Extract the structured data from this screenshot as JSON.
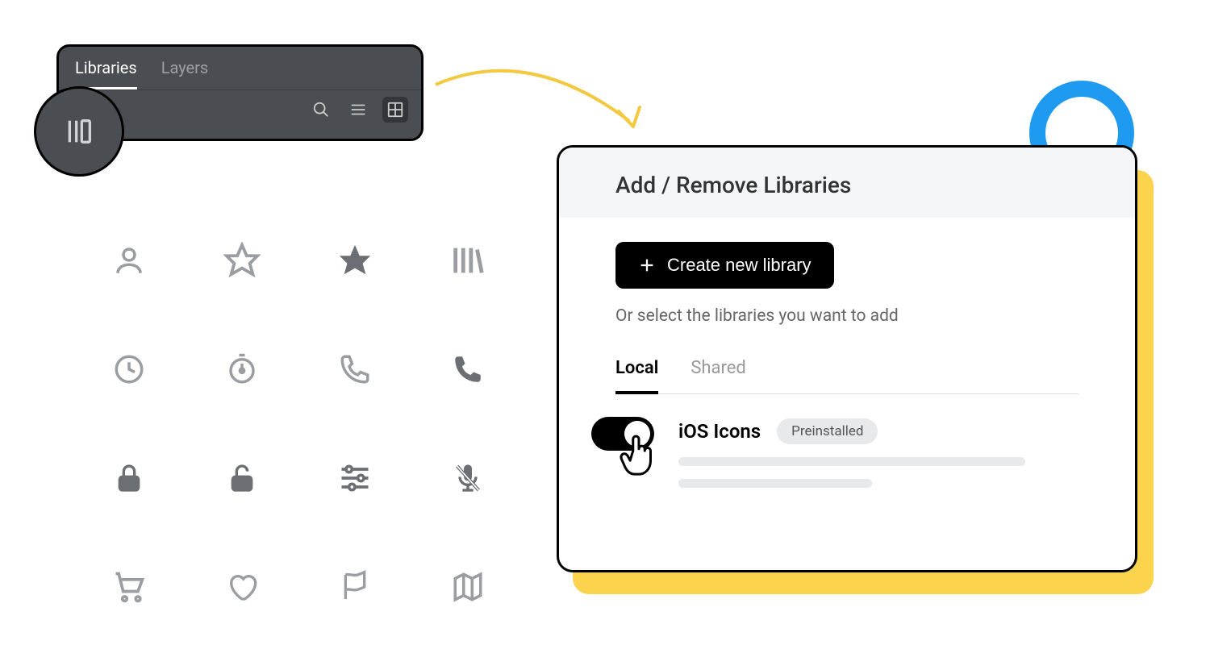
{
  "panel": {
    "tabs": [
      "Libraries",
      "Layers"
    ],
    "activeTab": "Libraries"
  },
  "iconGrid": [
    "user-icon",
    "star-outline-icon",
    "star-filled-icon",
    "library-books-icon",
    "clock-icon",
    "stopwatch-icon",
    "phone-outline-icon",
    "phone-filled-icon",
    "lock-closed-icon",
    "lock-open-icon",
    "sliders-icon",
    "mic-muted-icon",
    "shopping-cart-icon",
    "heart-icon",
    "flag-icon",
    "map-icon"
  ],
  "dialog": {
    "title": "Add / Remove Libraries",
    "createButton": "Create new library",
    "orText": "Or select the libraries you want to add",
    "subTabs": [
      "Local",
      "Shared"
    ],
    "activeSubTab": "Local",
    "library": {
      "name": "iOS Icons",
      "badge": "Preinstalled",
      "enabled": true
    }
  }
}
